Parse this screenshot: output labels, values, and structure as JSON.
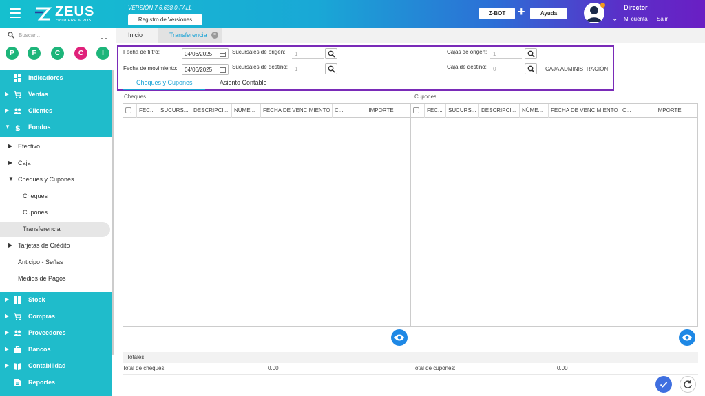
{
  "header": {
    "logo_text": "ZEUS",
    "logo_sub": "cloud ERP & POS",
    "version": "VERSIÓN 7.6.638.0-FALL",
    "registro_label": "Registro de Versiones",
    "zbot_label": "Z-BOT",
    "plus": "+",
    "ayuda_label": "Ayuda",
    "user_name": "Director",
    "mi_cuenta": "Mi cuenta",
    "salir": "Salir"
  },
  "sidebar": {
    "search_placeholder": "Buscar...",
    "quick": [
      {
        "letter": "P",
        "color": "#1db57a"
      },
      {
        "letter": "F",
        "color": "#1db57a"
      },
      {
        "letter": "C",
        "color": "#1db57a"
      },
      {
        "letter": "C",
        "color": "#e0207a"
      },
      {
        "letter": "I",
        "color": "#1db57a"
      }
    ],
    "items": {
      "indicadores": "Indicadores",
      "ventas": "Ventas",
      "clientes": "Clientes",
      "fondos": "Fondos",
      "efectivo": "Efectivo",
      "caja": "Caja",
      "cheques_cupones": "Cheques y Cupones",
      "cheques": "Cheques",
      "cupones": "Cupones",
      "transferencia": "Transferencia",
      "tarjetas": "Tarjetas de Crédito",
      "anticipo": "Anticipo - Señas",
      "medios": "Medios de Pagos",
      "stock": "Stock",
      "compras": "Compras",
      "proveedores": "Proveedores",
      "bancos": "Bancos",
      "contabilidad": "Contabilidad",
      "reportes": "Reportes"
    }
  },
  "tabs": {
    "inicio": "Inicio",
    "transferencia": "Transferencia",
    "close": "×"
  },
  "filters": {
    "fecha_filtro_label": "Fecha de filtro:",
    "fecha_filtro_value": "04/06/2025",
    "fecha_mov_label": "Fecha de movimiento:",
    "fecha_mov_value": "04/06/2025",
    "suc_origen_label": "Sucursales de origen:",
    "suc_origen_value": "1",
    "suc_destino_label": "Sucursales de destino:",
    "suc_destino_value": "1",
    "cajas_origen_label": "Cajas de origen:",
    "cajas_origen_value": "1",
    "caja_destino_label": "Caja de destino:",
    "caja_destino_value": "0",
    "caja_destino_name": "CAJA ADMINISTRACIÓN"
  },
  "subtabs": {
    "cheques_cupones": "Cheques y Cupones",
    "asiento": "Asiento Contable"
  },
  "cheques": {
    "title": "Cheques",
    "columns": [
      "FEC...",
      "SUCURS...",
      "DESCRIPCI...",
      "NÚME...",
      "FECHA DE VENCIMIENTO",
      "C...",
      "IMPORTE"
    ]
  },
  "cupones": {
    "title": "Cupones",
    "columns": [
      "FEC...",
      "SUCURS...",
      "DESCRIPCI...",
      "NÚME...",
      "FECHA DE VENCIMIENTO",
      "C...",
      "IMPORTE"
    ]
  },
  "totales": {
    "title": "Totales",
    "total_cheques_label": "Total de cheques:",
    "total_cheques_value": "0.00",
    "total_cupones_label": "Total de cupones:",
    "total_cupones_value": "0.00"
  },
  "colors": {
    "accent": "#1aa3d6",
    "sidebar_teal": "#1fbccb",
    "highlight_border": "#7a2bb8",
    "fab_blue": "#1e88e5"
  }
}
